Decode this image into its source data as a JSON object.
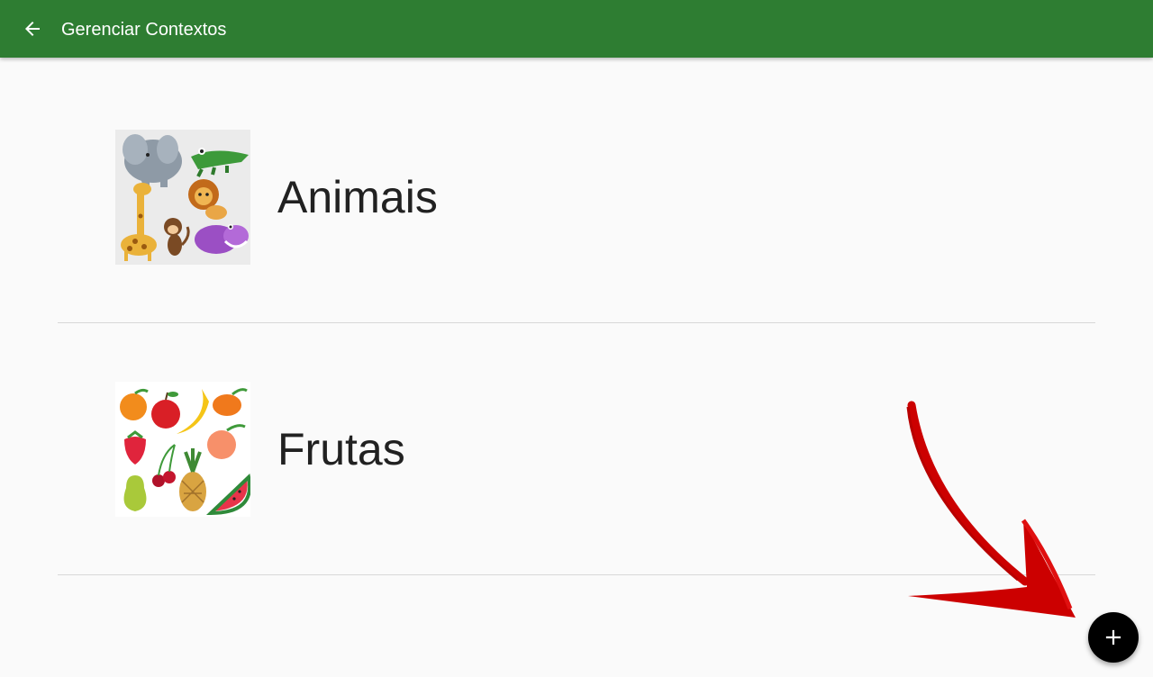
{
  "appbar": {
    "title": "Gerenciar Contextos",
    "back_icon": "arrow-left-icon",
    "color": "#2e7d32"
  },
  "contexts": [
    {
      "label": "Animais",
      "image": "animals-collage"
    },
    {
      "label": "Frutas",
      "image": "fruits-collage"
    }
  ],
  "fab": {
    "icon": "plus-icon",
    "color": "#000000"
  },
  "annotation": {
    "icon": "red-arrow-pointer",
    "color": "#cc0000"
  }
}
